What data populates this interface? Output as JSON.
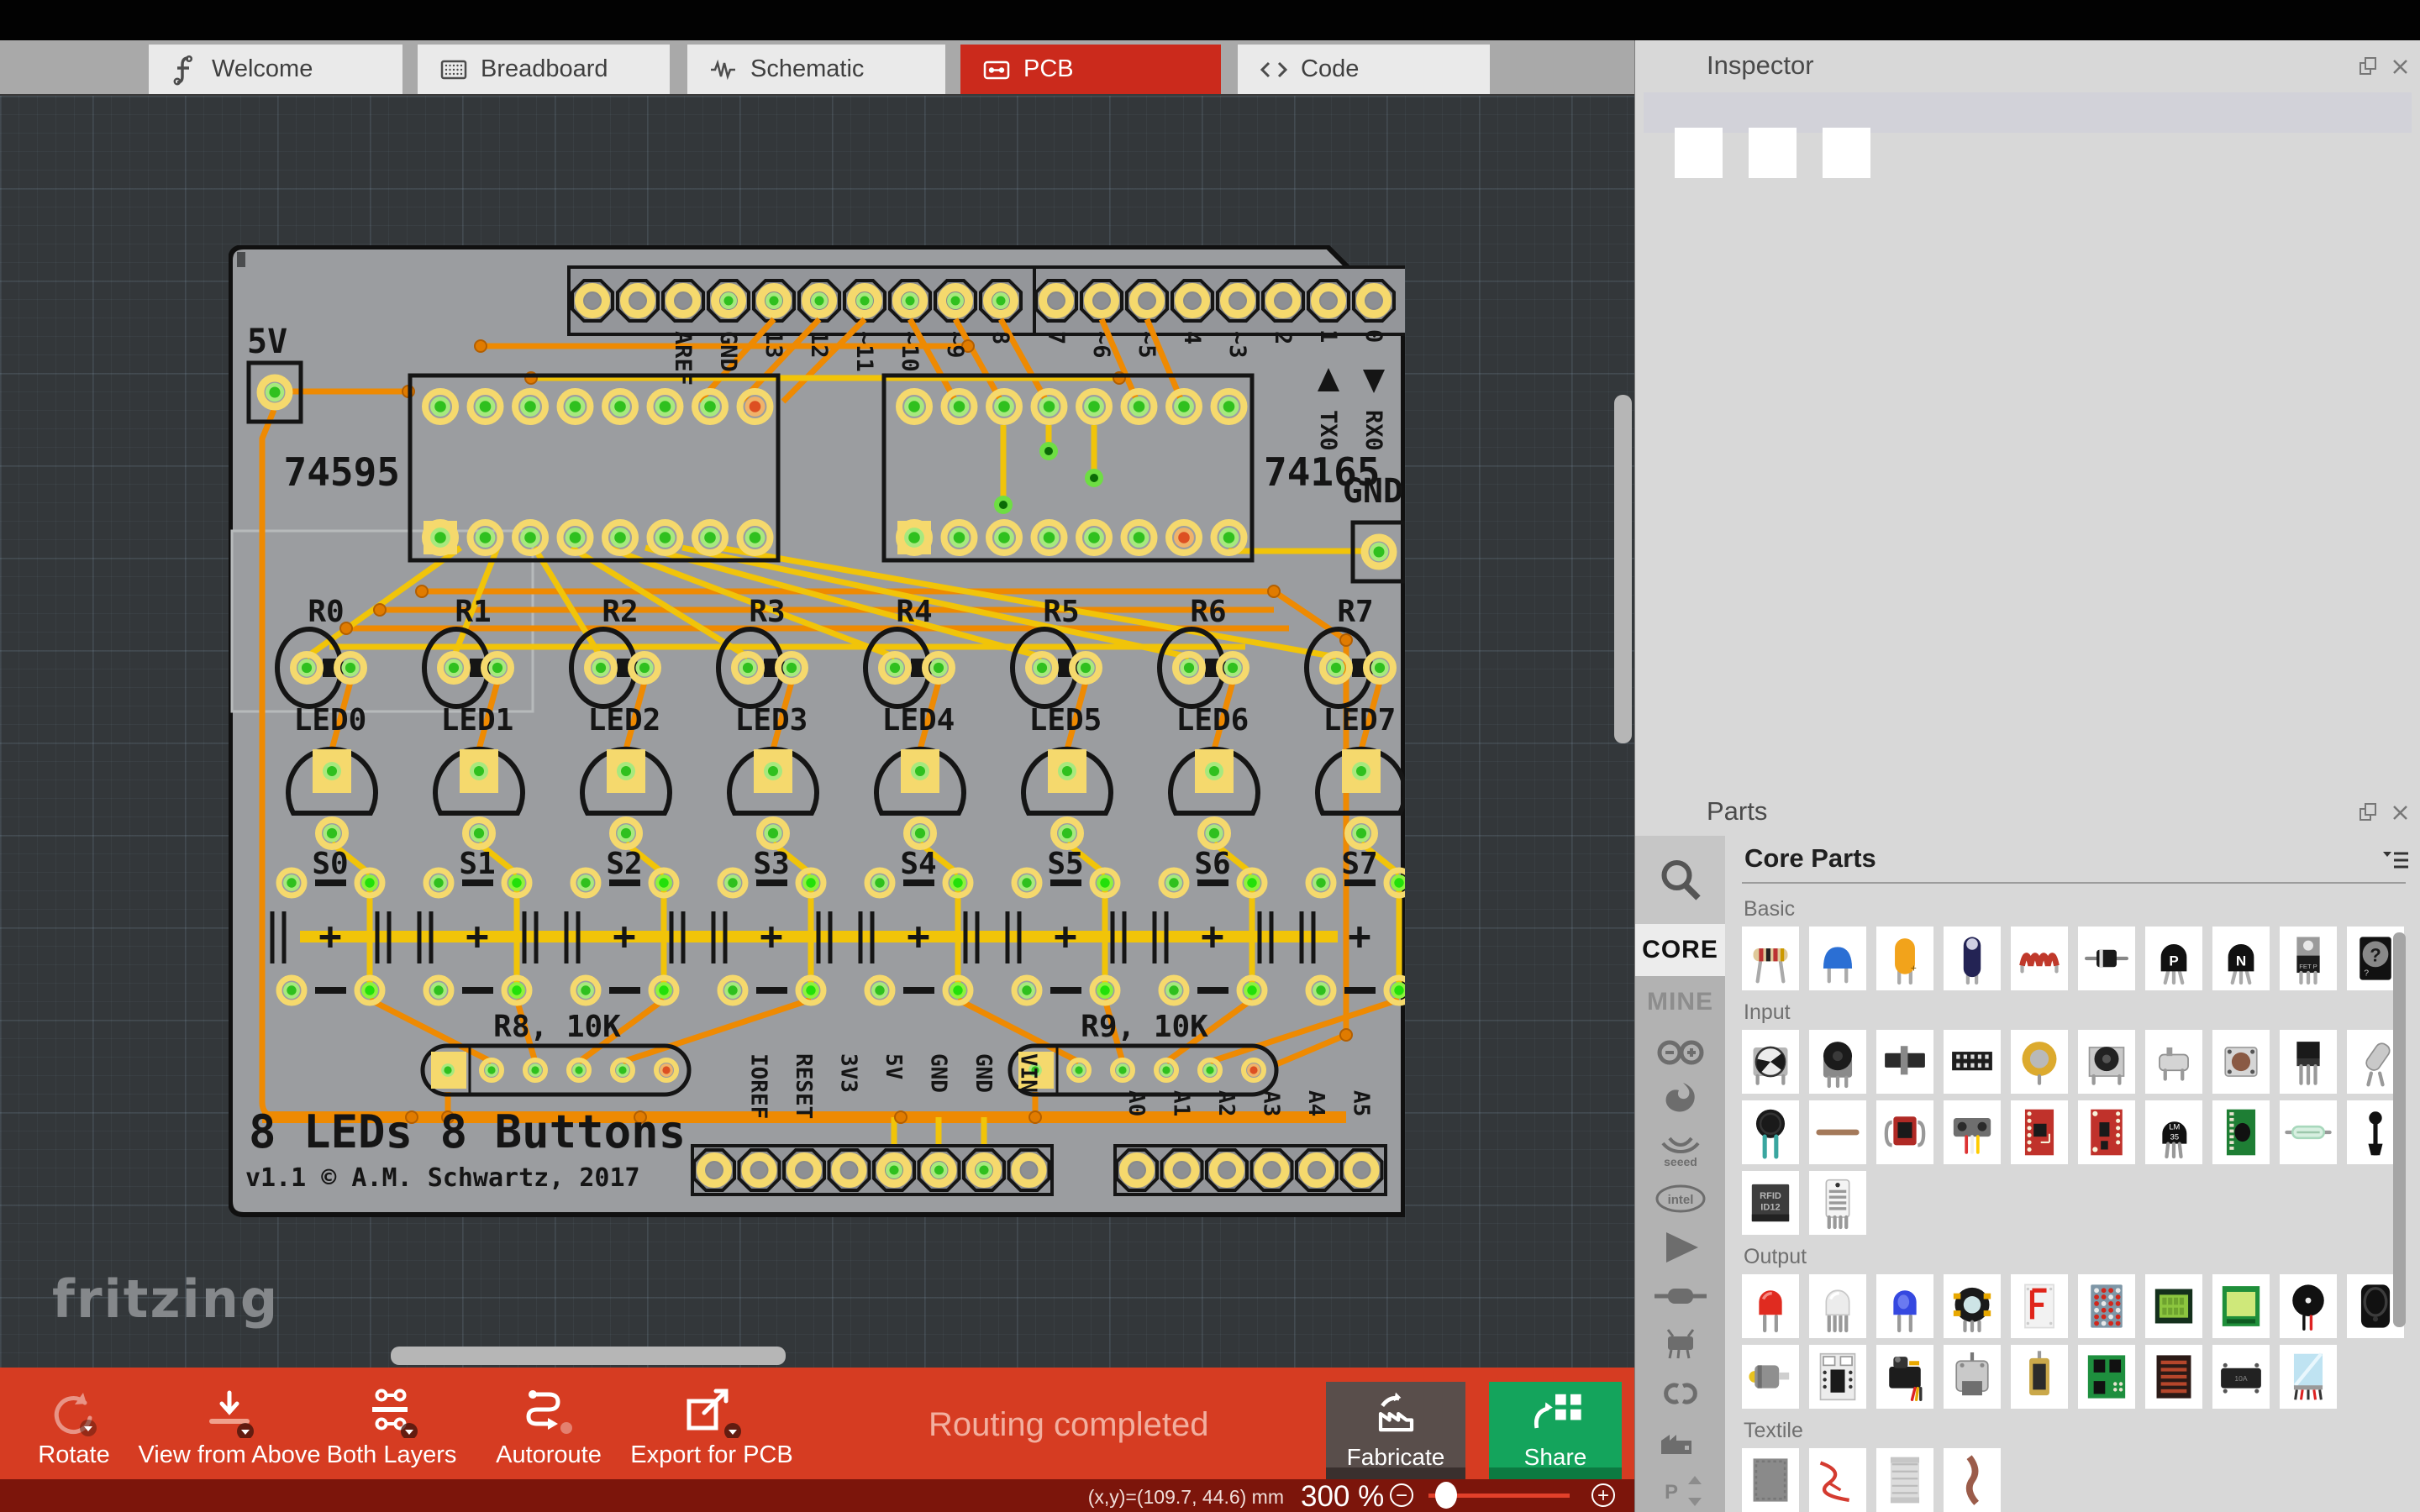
{
  "app": {
    "name": "Fritzing"
  },
  "tabs": [
    {
      "label": "Welcome",
      "icon": "fritzing-icon",
      "active": false
    },
    {
      "label": "Breadboard",
      "icon": "breadboard-icon",
      "active": false
    },
    {
      "label": "Schematic",
      "icon": "schematic-icon",
      "active": false
    },
    {
      "label": "PCB",
      "icon": "pcb-icon",
      "active": true
    },
    {
      "label": "Code",
      "icon": "code-icon",
      "active": false
    }
  ],
  "inspector": {
    "title": "Inspector"
  },
  "parts_panel": {
    "title": "Parts",
    "bin_title": "Core Parts",
    "rail": {
      "core": "CORE",
      "mine": "MINE",
      "vendors": [
        "arduino",
        "sparkfun",
        "seeed",
        "intel",
        "parallax",
        "component",
        "picaxe",
        "ct",
        "snootlab",
        "propeller-arrows"
      ]
    },
    "sections": [
      {
        "label": "Basic",
        "rows": [
          [
            {
              "n": "resistor"
            },
            {
              "n": "ceramic-capacitor"
            },
            {
              "n": "electrolytic-capacitor"
            },
            {
              "n": "tantalum-capacitor"
            },
            {
              "n": "inductor"
            },
            {
              "n": "diode"
            },
            {
              "n": "pnp-transistor",
              "text": "P"
            },
            {
              "n": "npn-transistor",
              "text": "N"
            },
            {
              "n": "mosfet"
            },
            {
              "n": "mystery-part",
              "text": "?"
            }
          ]
        ]
      },
      {
        "label": "Input",
        "rows": [
          [
            {
              "n": "trimmer-potentiometer"
            },
            {
              "n": "rotary-potentiometer"
            },
            {
              "n": "slide-potentiometer"
            },
            {
              "n": "dip-switch"
            },
            {
              "n": "piezo-sensor"
            },
            {
              "n": "rotary-encoder"
            },
            {
              "n": "micro-switch"
            },
            {
              "n": "pushbutton"
            },
            {
              "n": "voltage-regulator"
            },
            {
              "n": "tilt-sensor"
            }
          ],
          [
            {
              "n": "force-sensor"
            },
            {
              "n": "flex-sensor"
            },
            {
              "n": "photo-interrupter"
            },
            {
              "n": "distance-sensor"
            },
            {
              "n": "accelerometer-breakout"
            },
            {
              "n": "compass-breakout"
            },
            {
              "n": "temperature-sensor",
              "text": "LM 35"
            },
            {
              "n": "gas-sensor-board"
            },
            {
              "n": "reed-switch"
            },
            {
              "n": "electret-microphone"
            }
          ],
          [
            {
              "n": "rfid-reader",
              "text": "RFID ID12"
            },
            {
              "n": "humidity-sensor"
            }
          ]
        ]
      },
      {
        "label": "Output",
        "rows": [
          [
            {
              "n": "red-led"
            },
            {
              "n": "rgb-led"
            },
            {
              "n": "blue-led"
            },
            {
              "n": "led-holder"
            },
            {
              "n": "seven-segment-display",
              "text": "F"
            },
            {
              "n": "led-matrix"
            },
            {
              "n": "character-lcd"
            },
            {
              "n": "graphic-lcd"
            },
            {
              "n": "piezo-buzzer"
            },
            {
              "n": "loudspeaker"
            }
          ],
          [
            {
              "n": "dc-motor"
            },
            {
              "n": "motor-driver-board"
            },
            {
              "n": "servo-motor"
            },
            {
              "n": "stepper-motor"
            },
            {
              "n": "solenoid"
            },
            {
              "n": "h-bridge-board"
            },
            {
              "n": "heating-pad"
            },
            {
              "n": "relay-module"
            },
            {
              "n": "lcd-panel"
            }
          ]
        ]
      },
      {
        "label": "Textile",
        "rows": [
          [
            {
              "n": "conductive-fabric"
            },
            {
              "n": "conductive-thread-red"
            },
            {
              "n": "woven-conductive-fabric"
            },
            {
              "n": "conductive-thread-spool"
            }
          ]
        ]
      }
    ]
  },
  "pcb": {
    "title": "8 LEDs 8 Buttons",
    "version": "v1.1 © A.M. Schwartz, 2017",
    "ic1": "74595",
    "ic2": "74165",
    "label_5v": "5V",
    "label_gnd": "GND",
    "digital_labels": [
      "AREF",
      "GND",
      "13",
      "12",
      "~11",
      "~10",
      "~9",
      "8"
    ],
    "digital_labels2": [
      "7",
      "~6",
      "~5",
      "4",
      "~3",
      "2"
    ],
    "tx_label": "TX0",
    "tx_pin": "1",
    "rx_label": "RX0",
    "rx_pin": "0",
    "resistor_labels": [
      "R0",
      "R1",
      "R2",
      "R3",
      "R4",
      "R5",
      "R6",
      "R7"
    ],
    "led_labels": [
      "LED0",
      "LED1",
      "LED2",
      "LED3",
      "LED4",
      "LED5",
      "LED6",
      "LED7"
    ],
    "button_labels": [
      "S0",
      "S1",
      "S2",
      "S3",
      "S4",
      "S5",
      "S6",
      "S7"
    ],
    "network1_label": "R8, 10K",
    "network2_label": "R9, 10K",
    "power_labels": [
      "IOREF",
      "RESET",
      "3V3",
      "5V",
      "GND",
      "GND",
      "VIN"
    ],
    "analog_labels": [
      "A0",
      "A1",
      "A2",
      "A3",
      "A4",
      "A5"
    ]
  },
  "watermark": "fritzing",
  "toolbar": {
    "buttons": [
      {
        "label": "Rotate",
        "icon": "rotate-icon",
        "disabled": true
      },
      {
        "label": "View from Above",
        "icon": "view-from-above-icon",
        "disabled": false
      },
      {
        "label": "Both Layers",
        "icon": "both-layers-icon",
        "disabled": false
      },
      {
        "label": "Autoroute",
        "icon": "autoroute-icon",
        "disabled": false
      },
      {
        "label": "Export for PCB",
        "icon": "export-pcb-icon",
        "disabled": false
      }
    ],
    "status_message": "Routing completed",
    "fabricate_label": "Fabricate",
    "share_label": "Share"
  },
  "statusbar": {
    "coordinates": "(x,y)=(109.7, 44.6) mm",
    "zoom_value": "300",
    "zoom_unit": "%"
  },
  "colors": {
    "accent_red": "#d63c22",
    "active_tab": "#cb2a1c",
    "share_green": "#14a45c",
    "fabricate_gray": "#594e4b",
    "status_maroon": "#7c150b",
    "board_gray": "#9b9da0",
    "pad_yellow": "#f5d96d",
    "pad_green": "#2fc01e",
    "trace_orange": "#ee8a02",
    "trace_yellow": "#f1c409",
    "canvas_dark": "#33373a"
  }
}
